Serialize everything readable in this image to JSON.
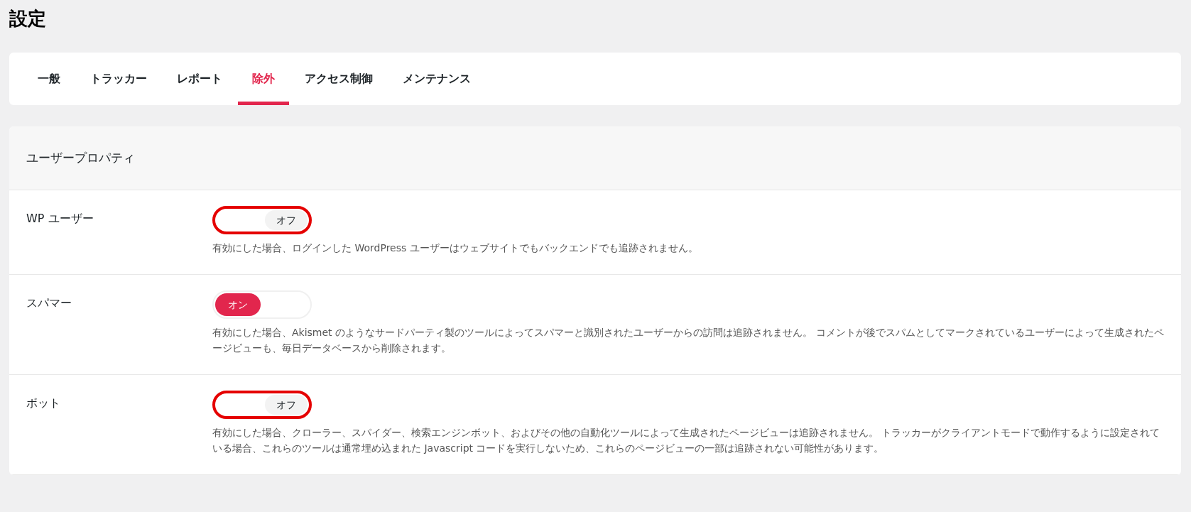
{
  "page_title": "設定",
  "tabs": [
    {
      "label": "一般",
      "selected": false
    },
    {
      "label": "トラッカー",
      "selected": false
    },
    {
      "label": "レポート",
      "selected": false
    },
    {
      "label": "除外",
      "selected": true
    },
    {
      "label": "アクセス制御",
      "selected": false
    },
    {
      "label": "メンテナンス",
      "selected": false
    }
  ],
  "section": {
    "title": "ユーザープロパティ",
    "rows": [
      {
        "label": "WP ユーザー",
        "on": false,
        "toggle_text": "オフ",
        "highlighted": true,
        "description": "有効にした場合、ログインした WordPress ユーザーはウェブサイトでもバックエンドでも追跡されません。"
      },
      {
        "label": "スパマー",
        "on": true,
        "toggle_text": "オン",
        "highlighted": false,
        "description": "有効にした場合、Akismet のようなサードパーティ製のツールによってスパマーと識別されたユーザーからの訪問は追跡されません。 コメントが後でスパムとしてマークされているユーザーによって生成されたページビューも、毎日データベースから削除されます。"
      },
      {
        "label": "ボット",
        "on": false,
        "toggle_text": "オフ",
        "highlighted": true,
        "description": "有効にした場合、クローラー、スパイダー、検索エンジンボット、およびその他の自動化ツールによって生成されたページビューは追跡されません。 トラッカーがクライアントモードで動作するように設定されている場合、これらのツールは通常埋め込まれた Javascript コードを実行しないため、これらのページビューの一部は追跡されない可能性があります。"
      }
    ]
  }
}
